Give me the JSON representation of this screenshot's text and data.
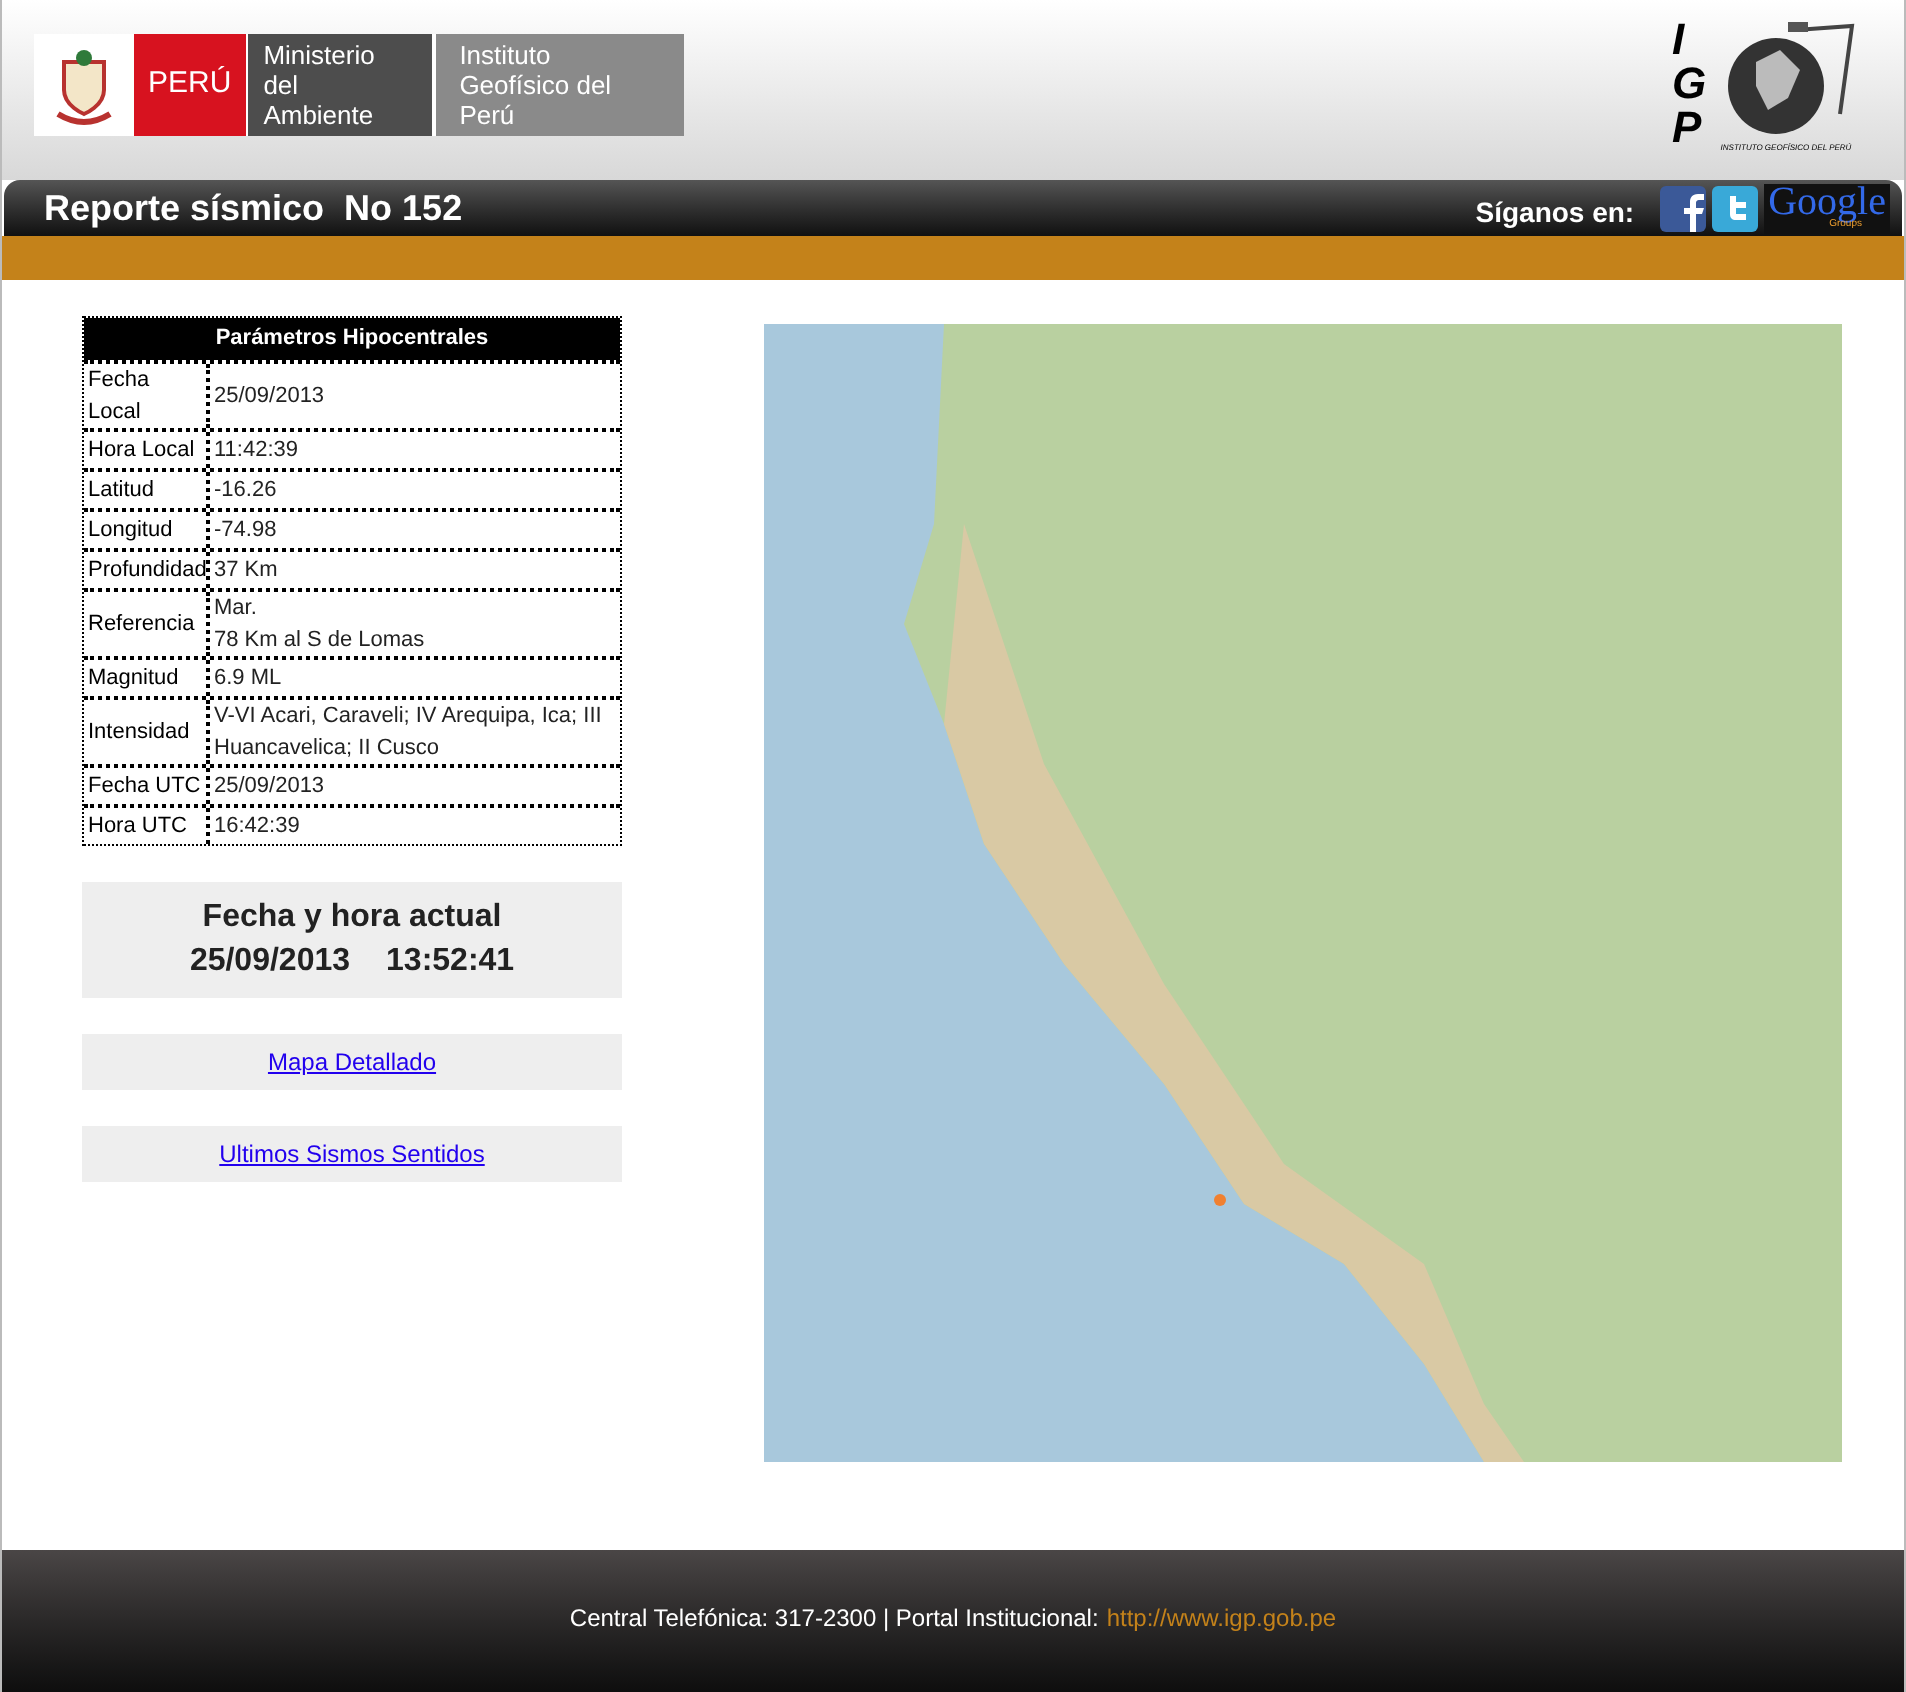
{
  "header": {
    "logo": {
      "country": "PERÚ",
      "ministry": "Ministerio del Ambiente",
      "institute": "Instituto Geofísico del Perú"
    },
    "igp_logo": {
      "letters": "IGP",
      "caption": "INSTITUTO GEOFÍSICO DEL PERÚ"
    }
  },
  "title_bar": {
    "title": "Reporte sísmico  No 152",
    "follow_label": "Síganos en:",
    "google": {
      "word": "Google",
      "sub": "Groups"
    }
  },
  "parameters": {
    "title": "Parámetros Hipocentrales",
    "rows": [
      {
        "label": "Fecha Local",
        "value": "25/09/2013"
      },
      {
        "label": "Hora Local",
        "value": "11:42:39"
      },
      {
        "label": "Latitud",
        "value": "-16.26"
      },
      {
        "label": "Longitud",
        "value": "-74.98"
      },
      {
        "label": "Profundidad",
        "value": "37 Km"
      },
      {
        "label": "Referencia",
        "value": "Mar.\n78 Km al S de Lomas"
      },
      {
        "label": "Magnitud",
        "value": "6.9 ML"
      },
      {
        "label": "Intensidad",
        "value": "V-VI Acari, Caraveli; IV Arequipa, Ica; III Huancavelica; II Cusco"
      },
      {
        "label": "Fecha UTC",
        "value": "25/09/2013"
      },
      {
        "label": "Hora UTC",
        "value": "16:42:39"
      }
    ]
  },
  "current_time": {
    "title": "Fecha y hora actual",
    "date": "25/09/2013",
    "time": "13:52:41"
  },
  "links": [
    "Mapa Detallado",
    "Ultimos Sismos Sentidos"
  ],
  "footer": {
    "text": "Central Telefónica: 317-2300 | Portal Institucional:",
    "link": "http://www.igp.gob.pe"
  }
}
